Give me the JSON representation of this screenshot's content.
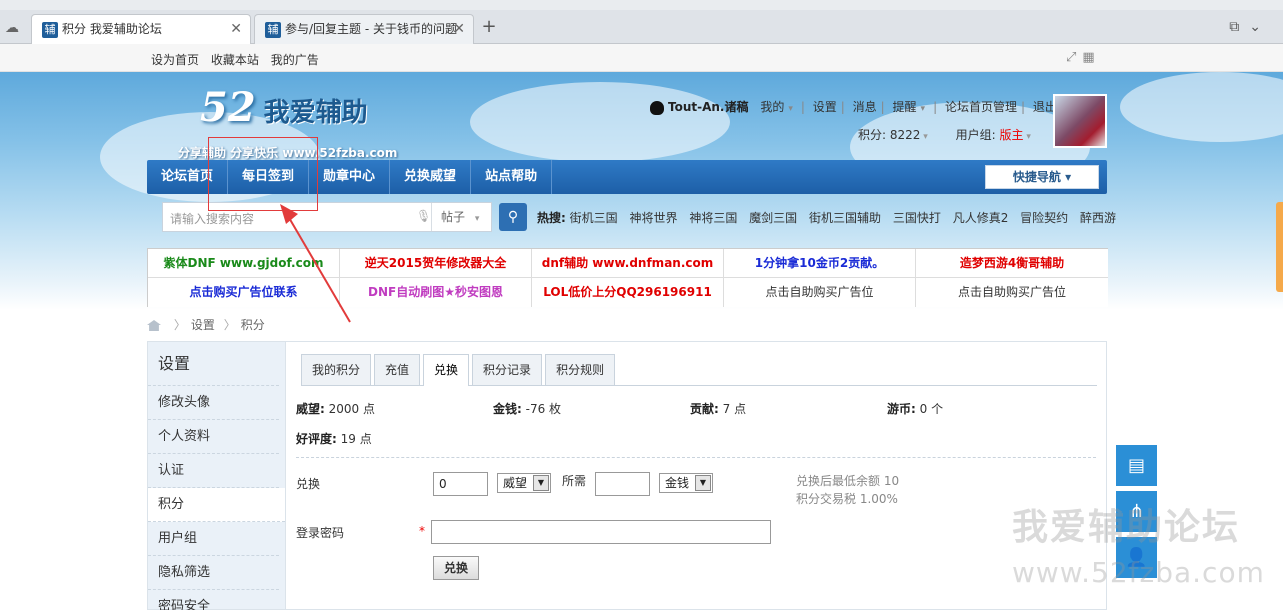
{
  "browser": {
    "tabs": [
      {
        "favicon": "辅",
        "label": "积分 我爱辅助论坛",
        "active": true
      },
      {
        "favicon": "辅",
        "label": "参与/回复主题 - 关于钱币的问题",
        "active": false
      }
    ]
  },
  "toplinks": [
    "设为首页",
    "收藏本站",
    "我的广告"
  ],
  "logo": {
    "number": "52",
    "name": "我爱辅助",
    "slogan": "分享辅助  分享快乐  www.52fzba.com"
  },
  "user": {
    "name": "Tout-An.诸稿",
    "links": [
      "我的",
      "设置",
      "消息",
      "提醒",
      "论坛首页管理",
      "退出"
    ],
    "points_label": "积分: 8222",
    "group_label": "用户组:",
    "group_value": "版主"
  },
  "nav": {
    "items": [
      "论坛首页",
      "每日签到",
      "勋章中心",
      "兑换威望",
      "站点帮助"
    ],
    "quick": "快捷导航"
  },
  "search": {
    "placeholder": "请输入搜索内容",
    "type": "帖子",
    "hot_label": "热搜:",
    "hot": [
      "街机三国",
      "神将世界",
      "神将三国",
      "魔剑三国",
      "街机三国辅助",
      "三国快打",
      "凡人修真2",
      "冒险契约",
      "醉西游"
    ]
  },
  "ads": [
    {
      "text": "紫体DNF www.gjdof.com",
      "color": "#1a8a1a"
    },
    {
      "text": "逆天2015贺年修改器大全",
      "color": "#e00000"
    },
    {
      "text": "dnf辅助 www.dnfman.com",
      "color": "#e00000"
    },
    {
      "text": "1分钟拿10金币2贡献。",
      "color": "#1a2bd6"
    },
    {
      "text": "造梦西游4衡哥辅助",
      "color": "#e00000"
    },
    {
      "text": "点击购买广告位联系",
      "color": "#1a2bd6"
    },
    {
      "text": "DNF自动刷图★秒安图恩",
      "color": "#c03cc0"
    },
    {
      "text": "LOL低价上分QQ296196911",
      "color": "#e00000"
    },
    {
      "text": "点击自助购买广告位",
      "color": "#333333"
    },
    {
      "text": "点击自助购买广告位",
      "color": "#333333"
    }
  ],
  "breadcrumb": [
    "设置",
    "积分"
  ],
  "menu": {
    "title": "设置",
    "items": [
      "修改头像",
      "个人资料",
      "认证",
      "积分",
      "用户组",
      "隐私筛选",
      "密码安全"
    ],
    "active": "积分"
  },
  "tabs": [
    "我的积分",
    "充值",
    "兑换",
    "积分记录",
    "积分规则"
  ],
  "active_tab": "兑换",
  "stats": [
    {
      "label": "威望:",
      "value": "2000 点"
    },
    {
      "label": "金钱:",
      "value": "-76 枚"
    },
    {
      "label": "贡献:",
      "value": "7 点"
    },
    {
      "label": "游币:",
      "value": "0 个"
    },
    {
      "label": "好评度:",
      "value": "19 点"
    }
  ],
  "exchange": {
    "label": "兑换",
    "amount": "0",
    "from_unit": "威望",
    "need_label": "所需",
    "need_value": "",
    "to_unit": "金钱",
    "note1": "兑换后最低余额 10",
    "note2": "积分交易税 1.00%",
    "password_label": "登录密码",
    "required_mark": "*",
    "submit": "兑换"
  },
  "watermark": {
    "line1": "我爱辅助论坛",
    "line2": "www.52fzba.com"
  }
}
